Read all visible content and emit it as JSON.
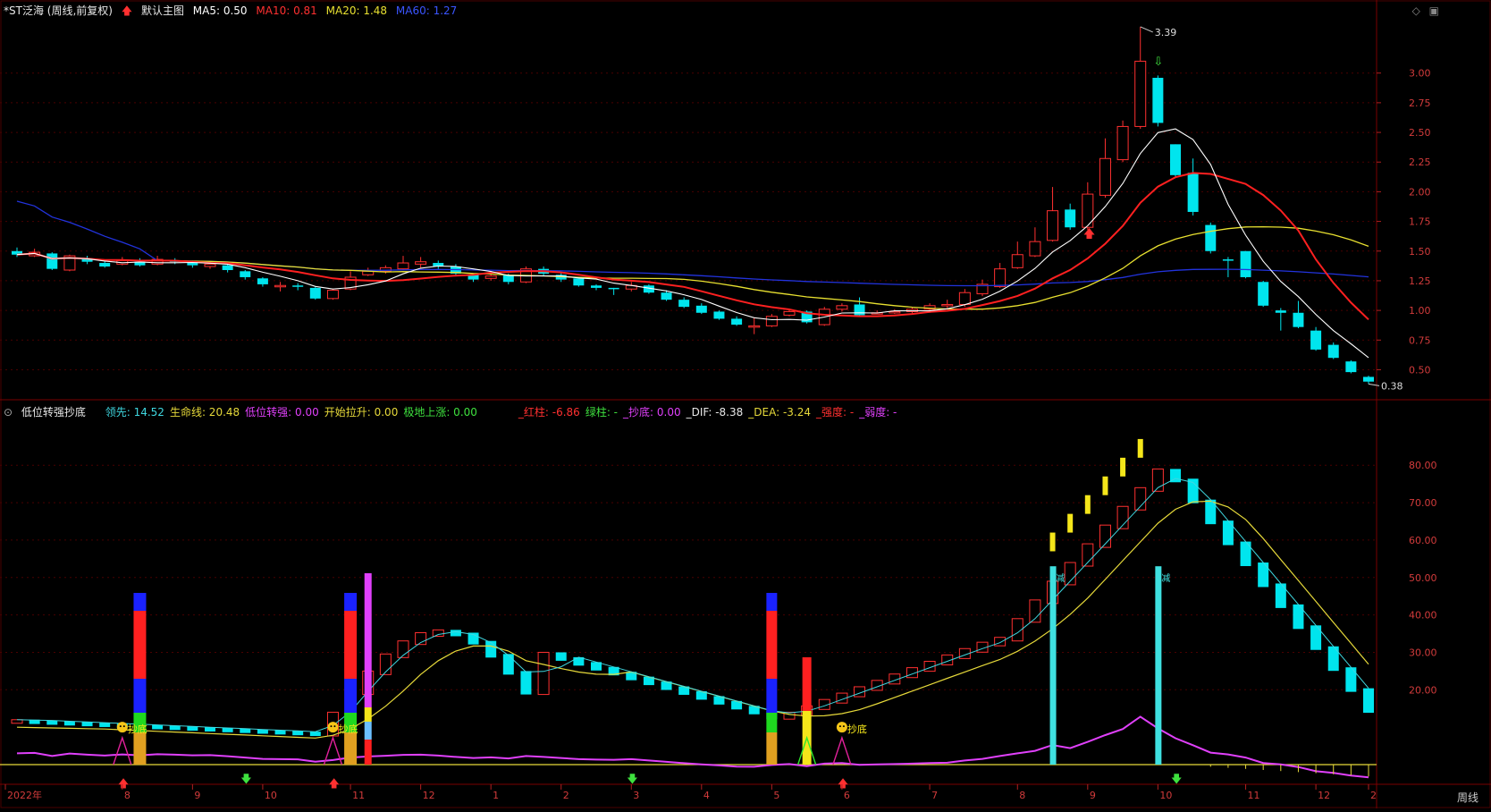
{
  "main_header": {
    "symbol": "*ST泛海 (周线,前复权)",
    "template": "默认主图",
    "ma5": "MA5: 0.50",
    "ma10": "MA10: 0.81",
    "ma20": "MA20: 1.48",
    "ma60": "MA60: 1.27"
  },
  "indicator_header": {
    "name": "低位转强抄底",
    "items": [
      {
        "text": "领先: 14.52",
        "color": "#3fd7e0"
      },
      {
        "text": "生命线: 20.48",
        "color": "#e6d93a"
      },
      {
        "text": "低位转强: 0.00",
        "color": "#e040fb"
      },
      {
        "text": "开始拉升: 0.00",
        "color": "#e6d93a"
      },
      {
        "text": "极地上涨: 0.00",
        "color": "#3ee03e"
      },
      {
        "text": "_红柱: -6.86",
        "color": "#ff3030"
      },
      {
        "text": "绿柱: -",
        "color": "#3ee03e"
      },
      {
        "text": "_抄底: 0.00",
        "color": "#e040fb"
      },
      {
        "text": "_DIF: -8.38",
        "color": "#e8e8e8"
      },
      {
        "text": "_DEA: -3.24",
        "color": "#e6d93a"
      },
      {
        "text": "_强度: -",
        "color": "#ff3030"
      },
      {
        "text": "_弱度: -",
        "color": "#e040fb"
      }
    ]
  },
  "price_axis": [
    "3.00",
    "2.75",
    "2.50",
    "2.25",
    "2.00",
    "1.75",
    "1.50",
    "1.25",
    "1.00",
    "0.75",
    "0.50"
  ],
  "indicator_axis": [
    "80.00",
    "70.00",
    "60.00",
    "50.00",
    "40.00",
    "30.00",
    "20.00"
  ],
  "x_axis": [
    "2022年",
    "8",
    "9",
    "10",
    "11",
    "12",
    "1",
    "2",
    "3",
    "4",
    "5",
    "6",
    "7",
    "8",
    "9",
    "10",
    "11",
    "12",
    "2"
  ],
  "period_label": "周线",
  "high_label": "3.39",
  "low_label": "0.38",
  "signal_label": "抄底",
  "reduce_label": "减",
  "colors": {
    "up": "#ff3030",
    "down": "#00e5ee",
    "ma5": "#ffffff",
    "ma10": "#ff2020",
    "ma20": "#e8e030",
    "ma60": "#2233dd",
    "grid": "#4a0000"
  },
  "chart_data": {
    "type": "candlestick",
    "period": "weekly",
    "ylim": [
      0.3,
      3.45
    ],
    "candles": [
      [
        1.5,
        1.47,
        1.53,
        1.45
      ],
      [
        1.46,
        1.49,
        1.52,
        1.45
      ],
      [
        1.48,
        1.35,
        1.49,
        1.34
      ],
      [
        1.34,
        1.46,
        1.47,
        1.33
      ],
      [
        1.44,
        1.41,
        1.46,
        1.39
      ],
      [
        1.4,
        1.37,
        1.42,
        1.36
      ],
      [
        1.39,
        1.42,
        1.45,
        1.38
      ],
      [
        1.41,
        1.38,
        1.44,
        1.37
      ],
      [
        1.39,
        1.43,
        1.46,
        1.38
      ],
      [
        1.42,
        1.41,
        1.44,
        1.39
      ],
      [
        1.4,
        1.38,
        1.42,
        1.36
      ],
      [
        1.37,
        1.39,
        1.41,
        1.35
      ],
      [
        1.38,
        1.34,
        1.39,
        1.32
      ],
      [
        1.33,
        1.28,
        1.34,
        1.26
      ],
      [
        1.27,
        1.22,
        1.28,
        1.2
      ],
      [
        1.2,
        1.21,
        1.24,
        1.16
      ],
      [
        1.21,
        1.2,
        1.23,
        1.17
      ],
      [
        1.19,
        1.1,
        1.2,
        1.09
      ],
      [
        1.1,
        1.17,
        1.18,
        1.09
      ],
      [
        1.18,
        1.28,
        1.33,
        1.17
      ],
      [
        1.3,
        1.33,
        1.36,
        1.29
      ],
      [
        1.33,
        1.36,
        1.38,
        1.31
      ],
      [
        1.35,
        1.4,
        1.46,
        1.34
      ],
      [
        1.39,
        1.41,
        1.45,
        1.36
      ],
      [
        1.4,
        1.37,
        1.42,
        1.35
      ],
      [
        1.37,
        1.31,
        1.39,
        1.3
      ],
      [
        1.3,
        1.26,
        1.31,
        1.24
      ],
      [
        1.27,
        1.29,
        1.31,
        1.25
      ],
      [
        1.3,
        1.24,
        1.31,
        1.22
      ],
      [
        1.24,
        1.35,
        1.37,
        1.23
      ],
      [
        1.35,
        1.31,
        1.37,
        1.29
      ],
      [
        1.3,
        1.26,
        1.32,
        1.24
      ],
      [
        1.27,
        1.21,
        1.27,
        1.2
      ],
      [
        1.21,
        1.19,
        1.22,
        1.17
      ],
      [
        1.19,
        1.18,
        1.19,
        1.13
      ],
      [
        1.18,
        1.21,
        1.24,
        1.16
      ],
      [
        1.21,
        1.15,
        1.22,
        1.14
      ],
      [
        1.15,
        1.09,
        1.17,
        1.08
      ],
      [
        1.09,
        1.03,
        1.11,
        1.02
      ],
      [
        1.04,
        0.98,
        1.06,
        0.97
      ],
      [
        0.99,
        0.93,
        1.0,
        0.92
      ],
      [
        0.93,
        0.88,
        0.95,
        0.87
      ],
      [
        0.87,
        0.87,
        0.94,
        0.8
      ],
      [
        0.87,
        0.95,
        0.97,
        0.86
      ],
      [
        0.96,
        0.99,
        1.01,
        0.95
      ],
      [
        0.99,
        0.9,
        1.0,
        0.89
      ],
      [
        0.88,
        1.01,
        1.03,
        0.87
      ],
      [
        1.01,
        1.04,
        1.06,
        0.99
      ],
      [
        1.05,
        0.96,
        1.11,
        0.95
      ],
      [
        0.98,
        0.98,
        1.0,
        0.97
      ],
      [
        0.99,
        0.99,
        1.01,
        0.97
      ],
      [
        0.99,
        1.01,
        1.03,
        0.97
      ],
      [
        1.01,
        1.04,
        1.06,
        0.98
      ],
      [
        1.04,
        1.05,
        1.09,
        1.02
      ],
      [
        1.05,
        1.15,
        1.18,
        1.03
      ],
      [
        1.14,
        1.22,
        1.26,
        1.12
      ],
      [
        1.2,
        1.35,
        1.4,
        1.19
      ],
      [
        1.36,
        1.47,
        1.58,
        1.35
      ],
      [
        1.46,
        1.58,
        1.7,
        1.45
      ],
      [
        1.59,
        1.84,
        2.04,
        1.58
      ],
      [
        1.85,
        1.7,
        1.9,
        1.68
      ],
      [
        1.7,
        1.98,
        2.08,
        1.68
      ],
      [
        1.97,
        2.28,
        2.45,
        1.95
      ],
      [
        2.27,
        2.55,
        2.6,
        2.25
      ],
      [
        2.55,
        3.1,
        3.39,
        2.53
      ],
      [
        2.96,
        2.58,
        2.98,
        2.55
      ],
      [
        2.4,
        2.14,
        2.4,
        2.12
      ],
      [
        2.16,
        1.83,
        2.28,
        1.8
      ],
      [
        1.72,
        1.5,
        1.74,
        1.48
      ],
      [
        1.43,
        1.42,
        1.45,
        1.28
      ],
      [
        1.5,
        1.28,
        1.5,
        1.27
      ],
      [
        1.24,
        1.04,
        1.25,
        1.03
      ],
      [
        1.0,
        0.98,
        1.02,
        0.83
      ],
      [
        0.98,
        0.86,
        1.08,
        0.85
      ],
      [
        0.83,
        0.67,
        0.86,
        0.66
      ],
      [
        0.71,
        0.6,
        0.73,
        0.59
      ],
      [
        0.57,
        0.48,
        0.58,
        0.47
      ],
      [
        0.44,
        0.4,
        0.45,
        0.38
      ]
    ],
    "annotations": {
      "high": 3.39,
      "low": 0.38
    }
  }
}
